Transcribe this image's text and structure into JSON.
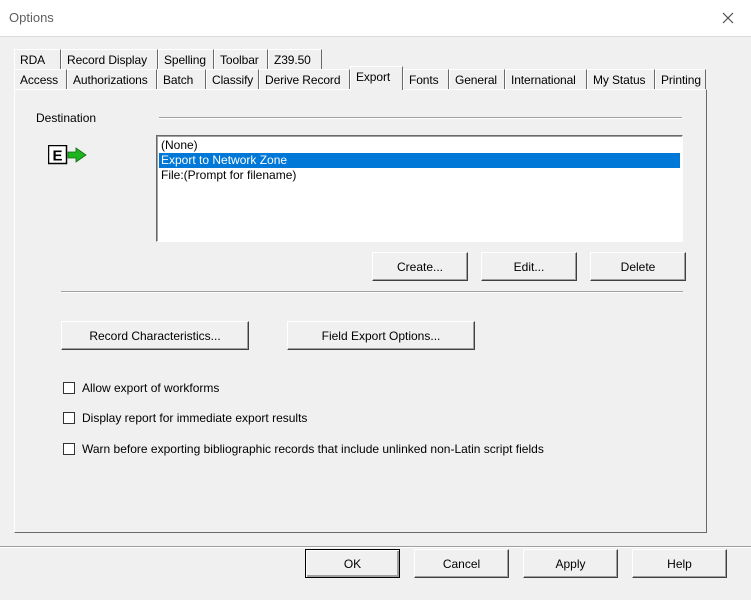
{
  "window": {
    "title": "Options"
  },
  "tabs": {
    "row1": [
      "RDA",
      "Record Display",
      "Spelling",
      "Toolbar",
      "Z39.50"
    ],
    "row2": [
      "Access",
      "Authorizations",
      "Batch",
      "Classify",
      "Derive Record",
      "Export",
      "Fonts",
      "General",
      "International",
      "My Status",
      "Printing"
    ],
    "active": "Export"
  },
  "destination": {
    "label": "Destination",
    "icon": "export-e-arrow-icon",
    "items": [
      "(None)",
      "Export to Network Zone",
      "File:(Prompt for filename)"
    ],
    "selected_index": 1
  },
  "dest_buttons": {
    "create": "Create...",
    "edit": "Edit...",
    "delete": "Delete"
  },
  "option_buttons": {
    "record_characteristics": "Record Characteristics...",
    "field_export_options": "Field Export Options..."
  },
  "checkboxes": [
    {
      "label": "Allow export of workforms",
      "checked": false
    },
    {
      "label": "Display report for immediate export results",
      "checked": false
    },
    {
      "label": "Warn before exporting bibliographic records that include unlinked non-Latin script fields",
      "checked": false
    }
  ],
  "dialog_buttons": {
    "ok": "OK",
    "cancel": "Cancel",
    "apply": "Apply",
    "help": "Help"
  },
  "colors": {
    "selection": "#0078d7",
    "icon_arrow": "#1fb41f"
  }
}
